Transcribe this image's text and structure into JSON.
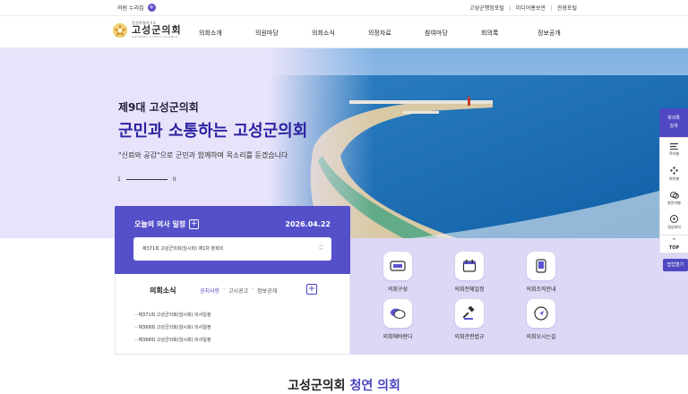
{
  "topbar": {
    "member_link": "의원 누리집",
    "member_badge": "+",
    "links": [
      "고성군행정포털",
      "미디어홍보관",
      "관광포털"
    ]
  },
  "logo": {
    "top": "강원특별자치도",
    "main": "고성군의회",
    "sub": "GOSEONG COUNTY COUNCIL"
  },
  "nav": [
    "의회소개",
    "의원마당",
    "의회소식",
    "의정자료",
    "참여마당",
    "회의록",
    "정보공개"
  ],
  "hero": {
    "small": "제9대 고성군의회",
    "big": "군민과 소통하는 고성군의회",
    "sub": "\"신뢰와 공감\"으로 군민과 함께하며 목소리를 듣겠습니다",
    "page": "1",
    "pause": "II"
  },
  "schedule": {
    "title": "오늘의 의사 일정",
    "plus": "+",
    "date": "2026.04.22",
    "selected": "제371회 고성군의회(임시회) 제1차 본회의",
    "arrow_up": "︿",
    "arrow_down": "﹀"
  },
  "news": {
    "title": "의회소식",
    "tabs": [
      "공지사항",
      "고시공고",
      "정보공개"
    ],
    "plus": "+",
    "items": [
      "제371회 고성군의회(임시회) 의사일정",
      "제369회 고성군의회(임시회) 의사일정",
      "제368회 고성군의회(임시회) 의사일정"
    ]
  },
  "quick": [
    {
      "label": "의회구성",
      "icon": "keyboard-icon"
    },
    {
      "label": "의회전체일정",
      "icon": "calendar-icon"
    },
    {
      "label": "의회조직안내",
      "icon": "phone-icon"
    },
    {
      "label": "의회에바란다",
      "icon": "chat-icon"
    },
    {
      "label": "의회관련법규",
      "icon": "gavel-icon"
    },
    {
      "label": "의회오시는길",
      "icon": "navigation-icon"
    }
  ],
  "floating": {
    "head": [
      "회의록",
      "검색"
    ],
    "items": [
      "목차별",
      "회의별",
      "발언자별",
      "영상회의"
    ],
    "top": "TOP",
    "popup": "팝업열기"
  },
  "bottom": {
    "text": "고성군의회",
    "accent": "청연 의회"
  },
  "colors": {
    "brand": "#4f48c2",
    "hero_bg": "#e8e3fa",
    "quick_bg": "#dcd8f6"
  }
}
